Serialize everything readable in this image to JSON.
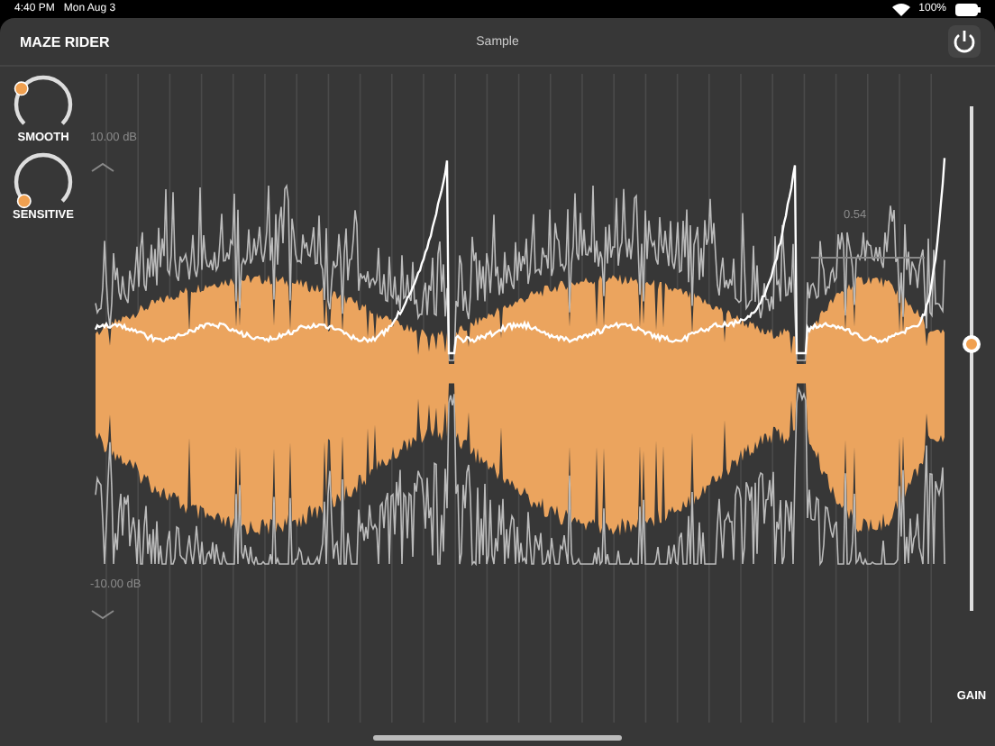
{
  "status_bar": {
    "time": "4:40 PM",
    "date": "Mon Aug 3",
    "battery": "100%"
  },
  "header": {
    "title": "MAZE RIDER",
    "document": "Sample"
  },
  "knobs": [
    {
      "label": "SMOOTH",
      "level": 0.3
    },
    {
      "label": "SENSITIVE",
      "level": 0
    }
  ],
  "meter": {
    "top_label": "10.00 dB",
    "bottom_label": "-10.00 dB",
    "threshold_label": "0.54"
  },
  "gain": {
    "label": "GAIN",
    "level": 0.53
  }
}
